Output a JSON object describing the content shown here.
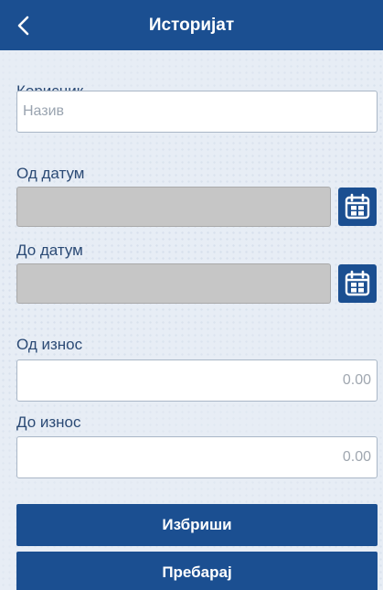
{
  "header": {
    "title": "Историјат",
    "back_icon": "chevron-left-icon"
  },
  "user": {
    "label": "Корисник",
    "placeholder": "Назив",
    "value": ""
  },
  "date_from": {
    "label": "Од датум",
    "value": "",
    "icon": "calendar-icon"
  },
  "date_to": {
    "label": "До датум",
    "value": "",
    "icon": "calendar-icon"
  },
  "amount_from": {
    "label": "Од износ",
    "placeholder": "0.00",
    "value": ""
  },
  "amount_to": {
    "label": "До износ",
    "placeholder": "0.00",
    "value": ""
  },
  "buttons": {
    "clear_label": "Избриши",
    "search_label": "Пребарај"
  },
  "colors": {
    "primary": "#1b4f91",
    "background": "#e7edf5",
    "disabled_field": "#c6c6c6"
  }
}
